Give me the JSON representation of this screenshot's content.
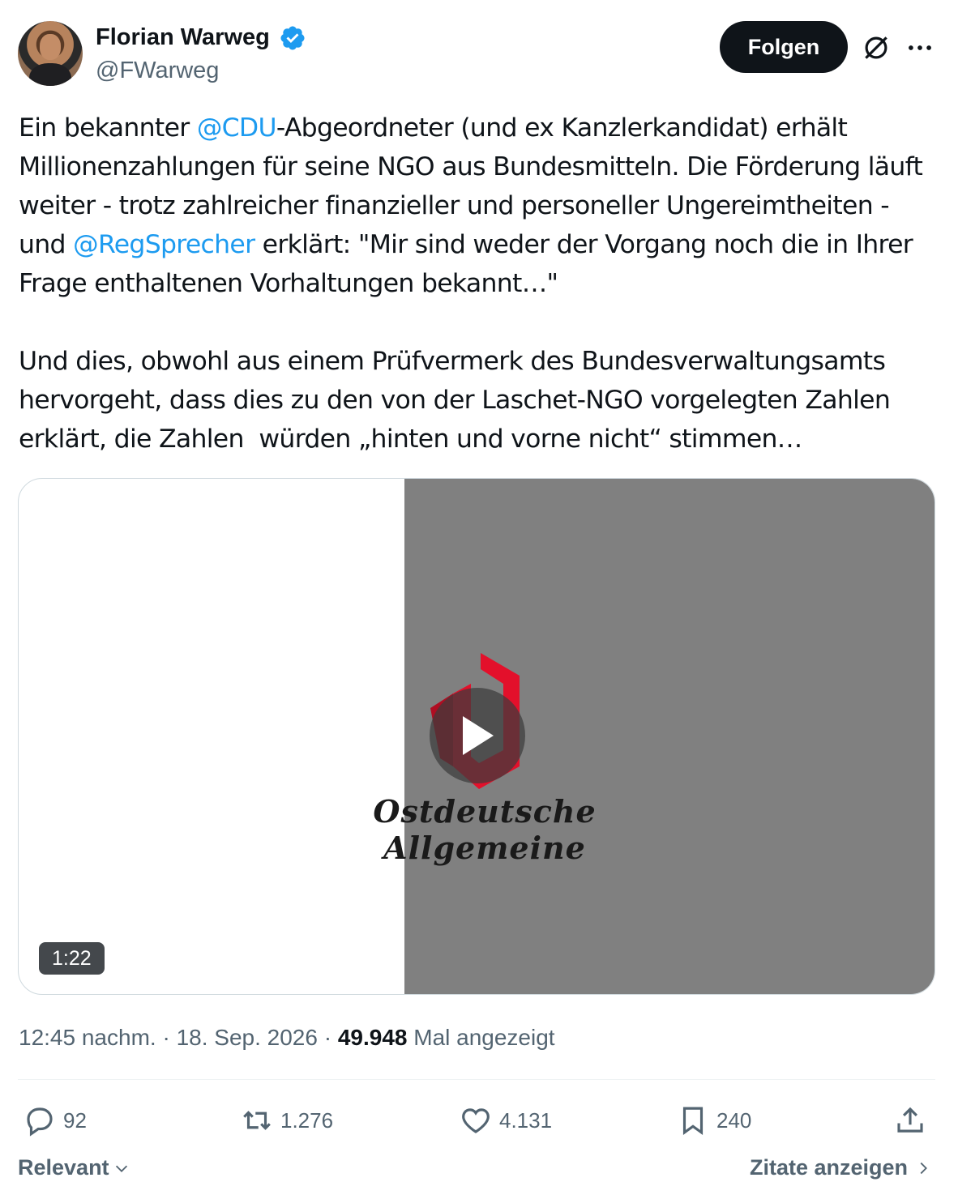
{
  "author": {
    "name": "Florian Warweg",
    "handle": "@FWarweg",
    "verified": true
  },
  "header": {
    "follow_label": "Folgen",
    "icons": [
      "grok-icon",
      "more-icon"
    ]
  },
  "tweet": {
    "segments": [
      {
        "text": "Ein bekannter ",
        "type": "text"
      },
      {
        "text": "@CDU",
        "type": "mention"
      },
      {
        "text": "-Abgeordneter (und ex Kanzlerkandidat) erhält Millionenzahlungen für seine NGO aus Bundesmitteln. Die Förderung läuft weiter - trotz zahlreicher finanzieller und personeller Ungereimtheiten - und ",
        "type": "text"
      },
      {
        "text": "@RegSprecher",
        "type": "mention"
      },
      {
        "text": " erklärt: \"Mir sind weder der Vorgang noch die in Ihrer Frage enthaltenen Vorhaltungen bekannt…\"\n\nUnd dies, obwohl aus einem Prüfvermerk des Bundesverwaltungsamts hervorgeht, dass dies zu den von der Laschet-NGO vorgelegten Zahlen erklärt, die Zahlen  würden „hinten und vorne nicht“ stimmen…",
        "type": "text"
      }
    ]
  },
  "media": {
    "logo_text": "Ostdeutsche Allgemeine",
    "duration": "1:22",
    "accent_color": "#e3102b"
  },
  "meta": {
    "time": "12:45 nachm.",
    "separator": "·",
    "date": "18. Sep. 2026",
    "views_count": "49.948",
    "views_label": "Mal angezeigt"
  },
  "actions": {
    "replies": "92",
    "reposts": "1.276",
    "likes": "4.131",
    "bookmarks": "240"
  },
  "footer": {
    "sort_label": "Relevant",
    "quotes_label": "Zitate anzeigen"
  },
  "colors": {
    "link": "#1d9bf0",
    "muted": "#536471",
    "text": "#0f1419"
  }
}
